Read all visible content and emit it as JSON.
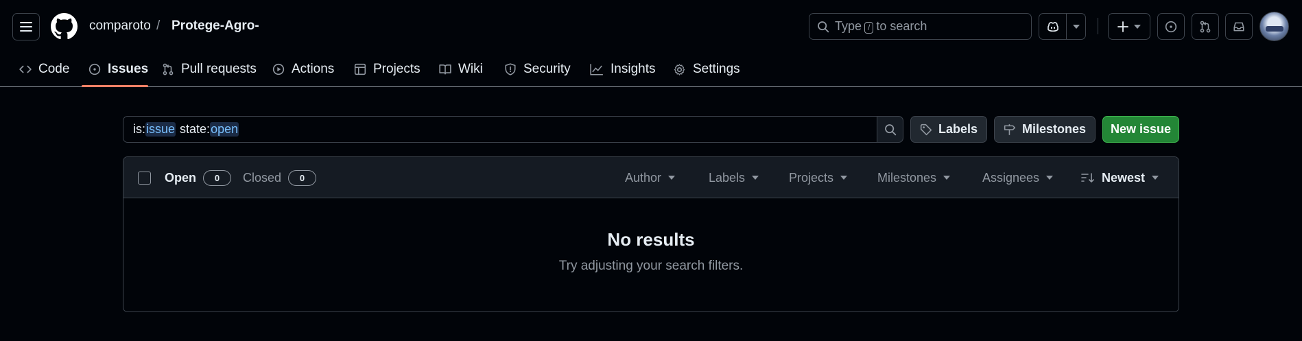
{
  "header": {
    "owner": "comparoto",
    "separator": "/",
    "repo": "Protege-Agro-",
    "search": {
      "prefix": "Type",
      "key": "/",
      "suffix": "to search"
    }
  },
  "repo_nav": {
    "items": [
      {
        "label": "Code",
        "icon": "code-icon"
      },
      {
        "label": "Issues",
        "icon": "issue-opened-icon",
        "active": true
      },
      {
        "label": "Pull requests",
        "icon": "git-pull-request-icon"
      },
      {
        "label": "Actions",
        "icon": "play-icon"
      },
      {
        "label": "Projects",
        "icon": "table-icon"
      },
      {
        "label": "Wiki",
        "icon": "book-icon"
      },
      {
        "label": "Security",
        "icon": "shield-icon"
      },
      {
        "label": "Insights",
        "icon": "graph-icon"
      },
      {
        "label": "Settings",
        "icon": "gear-icon"
      }
    ]
  },
  "filter_bar": {
    "query": {
      "q1_key": "is:",
      "q1_val": "issue",
      "q2_key": "state:",
      "q2_val": "open"
    },
    "labels_button": "Labels",
    "milestones_button": "Milestones",
    "new_issue_button": "New issue"
  },
  "issues_list": {
    "open_label": "Open",
    "open_count": "0",
    "closed_label": "Closed",
    "closed_count": "0",
    "filters": {
      "author": "Author",
      "labels": "Labels",
      "projects": "Projects",
      "milestones": "Milestones",
      "assignees": "Assignees",
      "sort": "Newest"
    },
    "empty_title": "No results",
    "empty_subtitle": "Try adjusting your search filters."
  },
  "colors": {
    "background": "#010409",
    "primary_button": "#238636",
    "active_tab_underline": "#f78166",
    "query_value": "#79c0ff"
  }
}
